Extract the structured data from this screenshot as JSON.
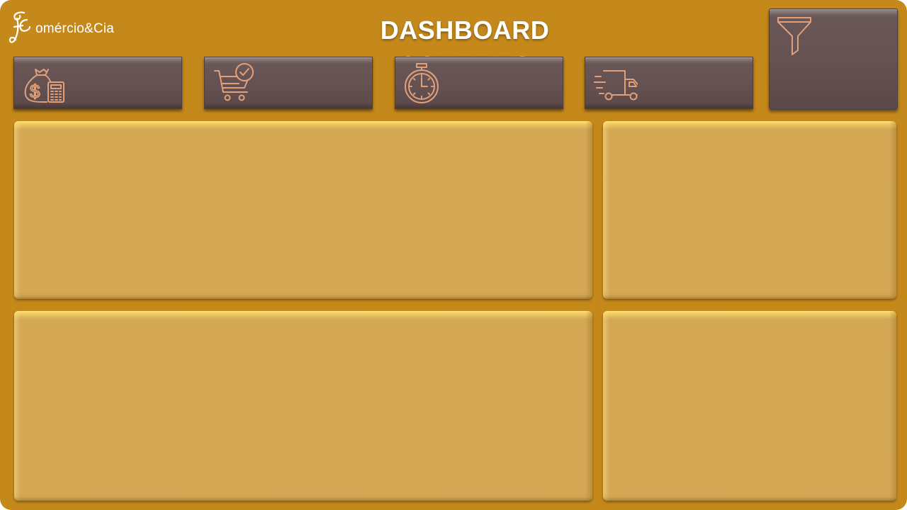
{
  "header": {
    "logo_text": "omércio&Cia",
    "title": "DASHBOARD COMPRAS"
  },
  "kpis": [
    {
      "id": "valor-compras",
      "icon": "money-bag-calculator-icon",
      "value": ""
    },
    {
      "id": "pedidos",
      "icon": "shopping-cart-check-icon",
      "value": ""
    },
    {
      "id": "tempo",
      "icon": "stopwatch-icon",
      "value": ""
    },
    {
      "id": "entregas",
      "icon": "delivery-truck-icon",
      "value": ""
    }
  ],
  "filter": {
    "icon": "funnel-filter-icon"
  },
  "panels": [
    "chart-panel-top-left",
    "chart-panel-top-right",
    "chart-panel-bottom-left",
    "chart-panel-bottom-right"
  ],
  "colors": {
    "background": "#C5891B",
    "card": "#655151",
    "panel": "#D4A855",
    "icon_stroke": "#E0A07A"
  }
}
